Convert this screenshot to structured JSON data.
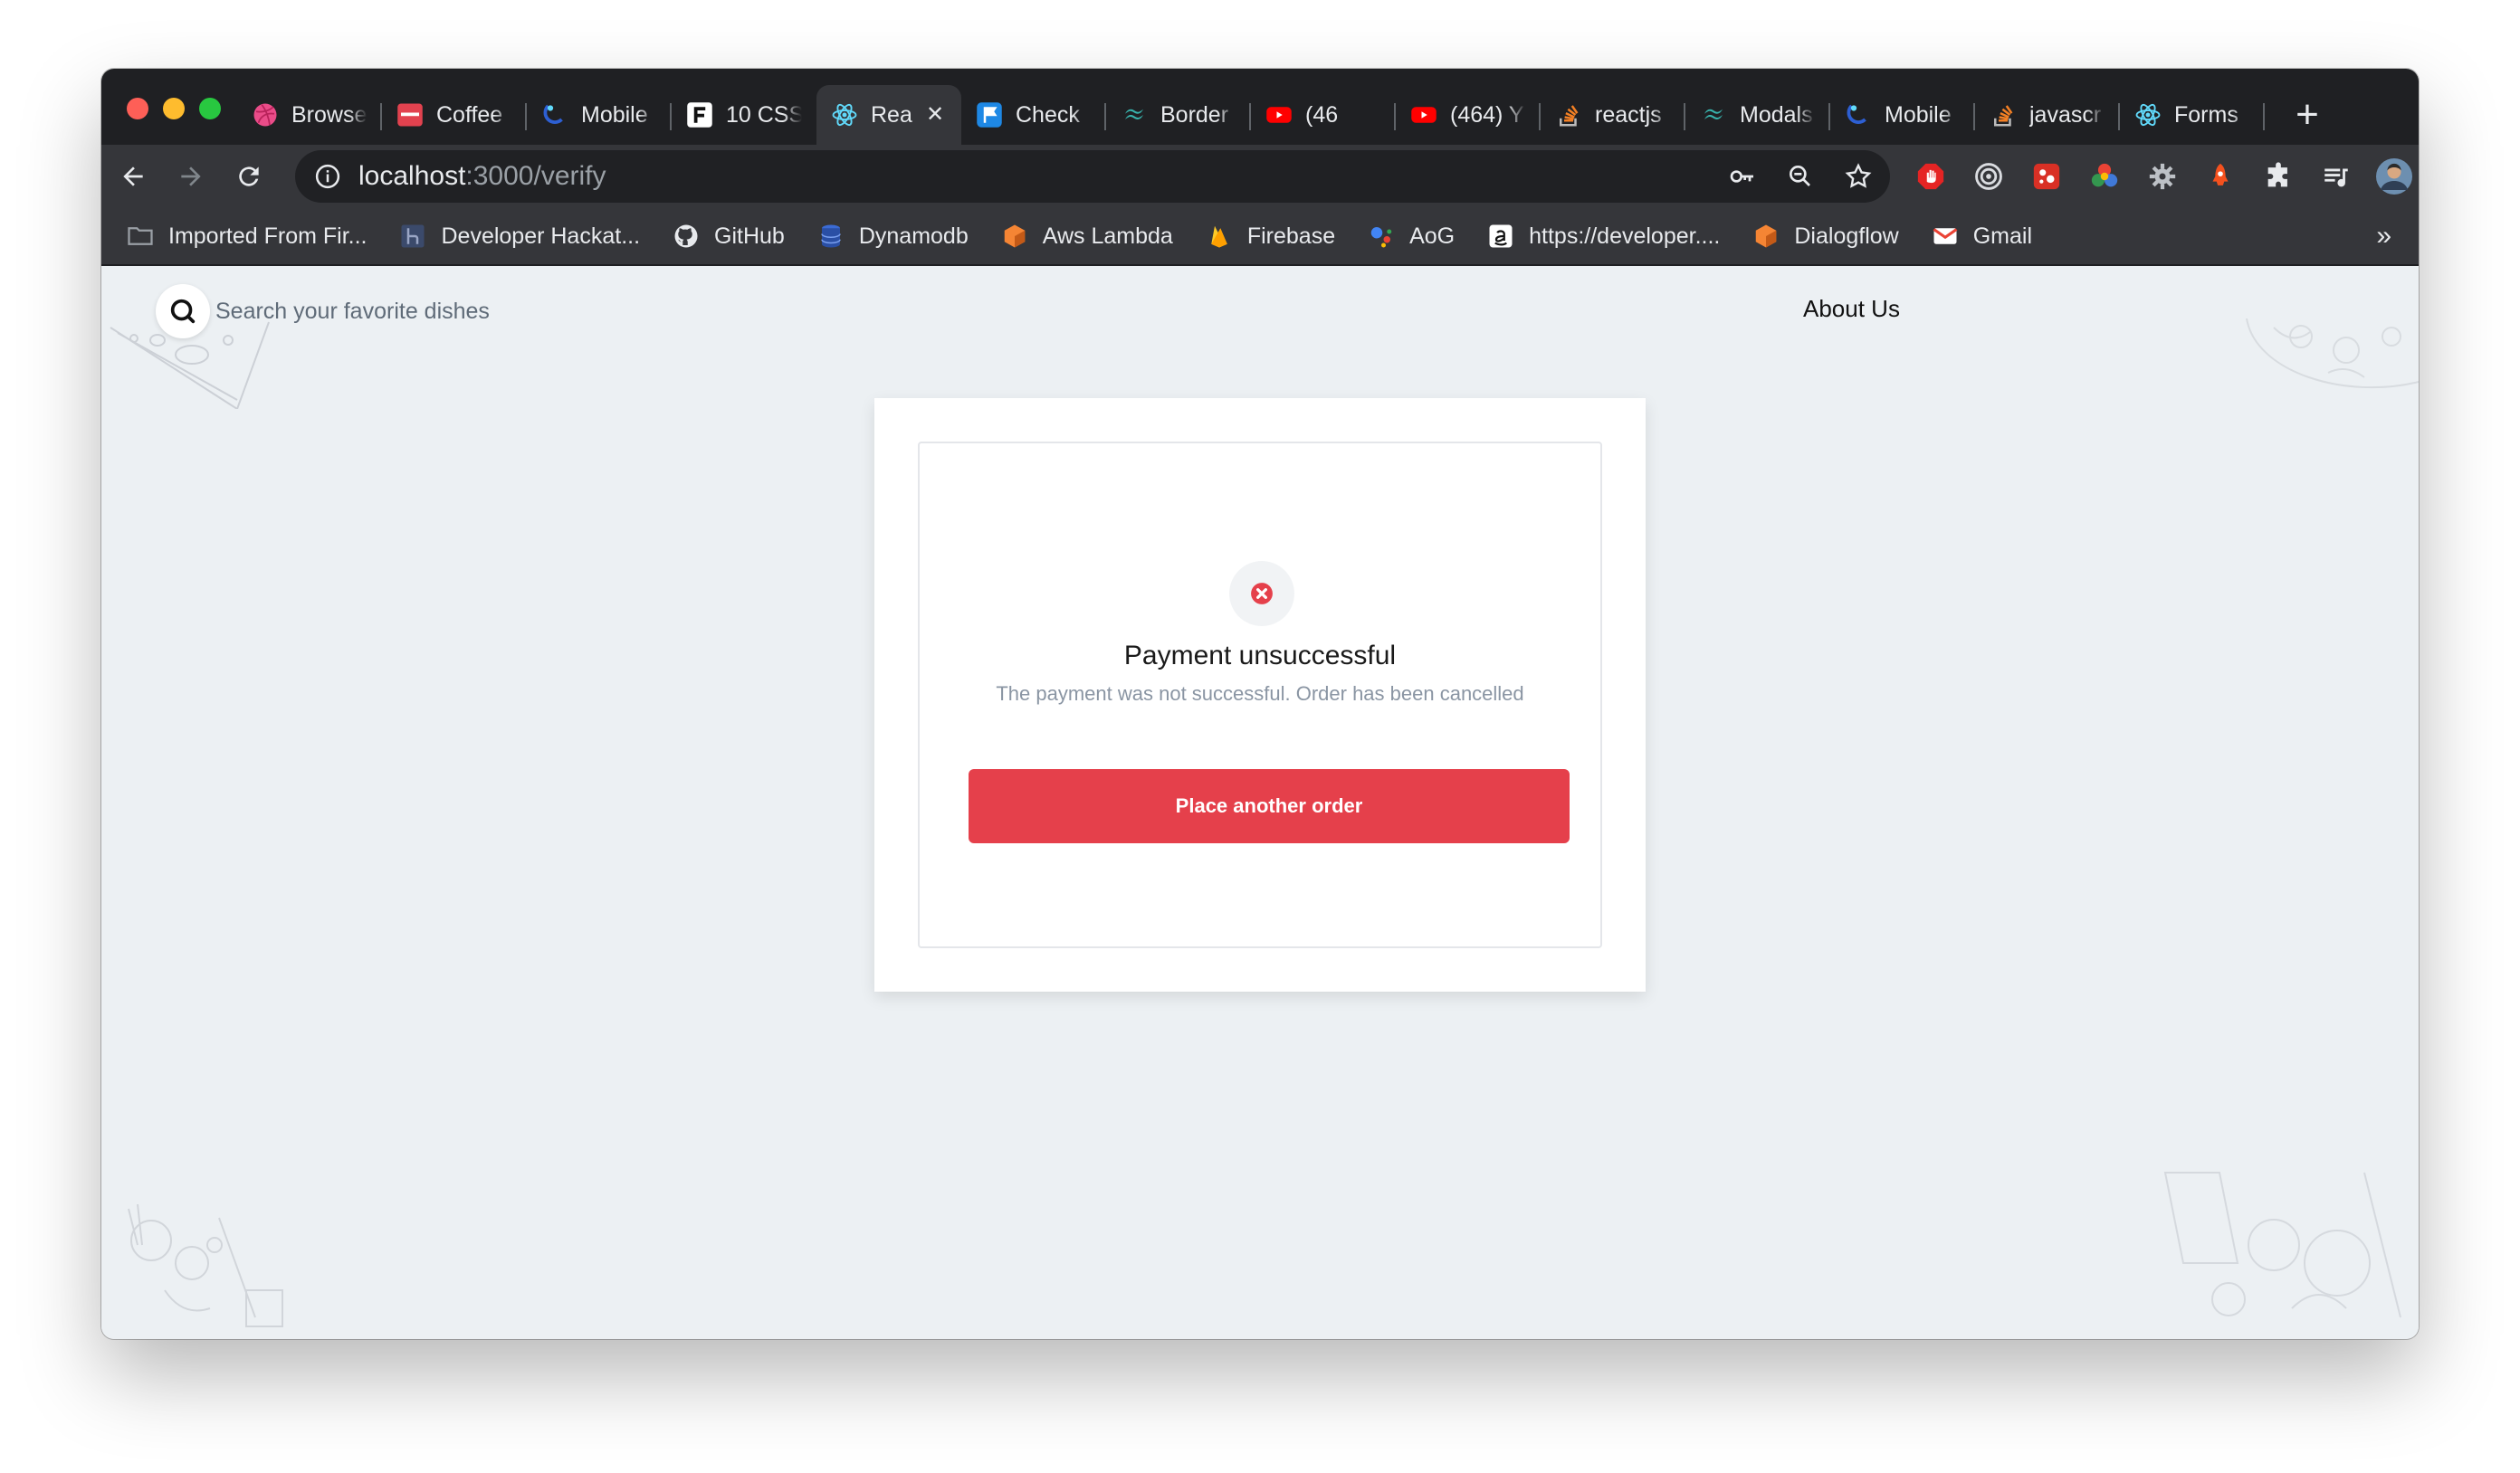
{
  "browser": {
    "tabs": [
      {
        "label": "Browse",
        "icon": "dribbble-icon",
        "color": "#ea4c89",
        "active": false
      },
      {
        "label": "Coffee",
        "icon": "coffee-icon",
        "color": "#e2424f",
        "active": false
      },
      {
        "label": "Mobile",
        "icon": "mobile-icon",
        "color": "#2d5fd3",
        "active": false
      },
      {
        "label": "10 CSS",
        "icon": "letter-f-icon",
        "color": "#ffffff",
        "active": false
      },
      {
        "label": "Rea",
        "icon": "react-icon",
        "color": "#61dafb",
        "active": true
      },
      {
        "label": "Check",
        "icon": "flag-icon",
        "color": "#1e88e5",
        "active": false
      },
      {
        "label": "Border",
        "icon": "tailwind-icon",
        "color": "#38b2ac",
        "active": false
      },
      {
        "label": "(46",
        "icon": "youtube-icon",
        "color": "#ff0000",
        "active": false
      },
      {
        "label": "(464) Y",
        "icon": "youtube-icon",
        "color": "#ff0000",
        "active": false
      },
      {
        "label": "reactjs",
        "icon": "stackoverflow-icon",
        "color": "#f48024",
        "active": false
      },
      {
        "label": "Modals",
        "icon": "tailwind-icon",
        "color": "#38b2ac",
        "active": false
      },
      {
        "label": "Mobile",
        "icon": "mobile-icon",
        "color": "#2d5fd3",
        "active": false
      },
      {
        "label": "javascr",
        "icon": "stackoverflow-icon",
        "color": "#f48024",
        "active": false
      },
      {
        "label": "Forms",
        "icon": "react-icon",
        "color": "#61dafb",
        "active": false
      }
    ],
    "url_host": "localhost",
    "url_rest": ":3000/verify",
    "bookmarks": [
      {
        "label": "Imported From Fir...",
        "icon": "folder-icon",
        "color": "#9aa0a6"
      },
      {
        "label": "Developer Hackat...",
        "icon": "hackathon-icon",
        "color": "#3b4a6b"
      },
      {
        "label": "GitHub",
        "icon": "github-icon",
        "color": "#e8eaed"
      },
      {
        "label": "Dynamodb",
        "icon": "dynamodb-icon",
        "color": "#3b6bd4"
      },
      {
        "label": "Aws Lambda",
        "icon": "aws-icon",
        "color": "#f58534"
      },
      {
        "label": "Firebase",
        "icon": "firebase-icon",
        "color": "#ffca28"
      },
      {
        "label": "AoG",
        "icon": "google-assistant-icon",
        "color": "#4285f4"
      },
      {
        "label": "https://developer....",
        "icon": "amazon-icon",
        "color": "#ffffff"
      },
      {
        "label": "Dialogflow",
        "icon": "dialogflow-icon",
        "color": "#f58534"
      },
      {
        "label": "Gmail",
        "icon": "gmail-icon",
        "color": "#ea4335"
      }
    ],
    "bookmarks_more": "»"
  },
  "page": {
    "search_placeholder": "Search your favorite dishes",
    "about_link": "About Us",
    "card": {
      "title": "Payment unsuccessful",
      "message": "The payment was not successful. Order has been cancelled",
      "button": "Place another order"
    },
    "colors": {
      "accent": "#e5404b",
      "page_bg": "#ecf0f3"
    }
  }
}
